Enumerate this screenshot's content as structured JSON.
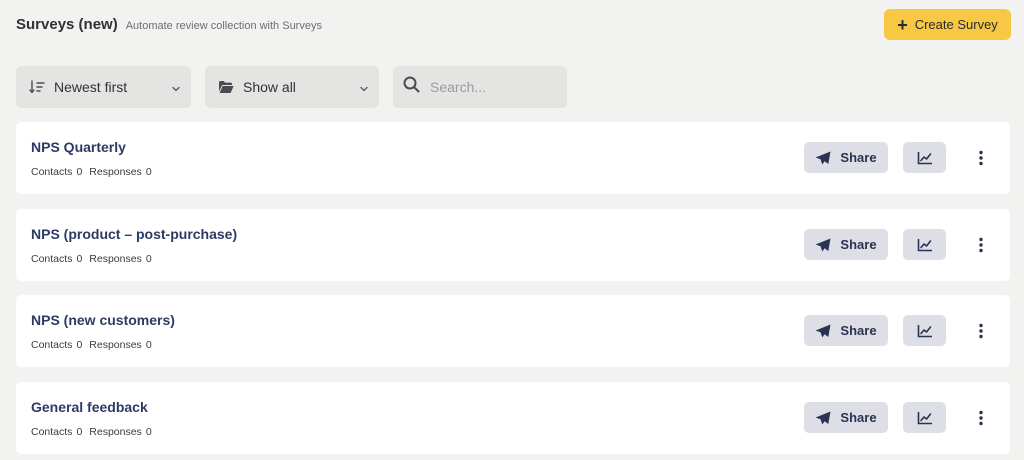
{
  "header": {
    "title": "Surveys (new)",
    "subtitle": "Automate review collection with Surveys",
    "create_label": "Create Survey"
  },
  "filters": {
    "sort": {
      "label": "Newest first",
      "icon": "sort-descending-icon"
    },
    "folder": {
      "label": "Show all",
      "icon": "folder-open-icon"
    },
    "search": {
      "placeholder": "Search...",
      "value": ""
    }
  },
  "surveys": [
    {
      "name": "NPS Quarterly",
      "contacts_label": "Contacts",
      "contacts": "0",
      "responses_label": "Responses",
      "responses": "0",
      "share_label": "Share"
    },
    {
      "name": "NPS (product – post-purchase)",
      "contacts_label": "Contacts",
      "contacts": "0",
      "responses_label": "Responses",
      "responses": "0",
      "share_label": "Share"
    },
    {
      "name": "NPS (new customers)",
      "contacts_label": "Contacts",
      "contacts": "0",
      "responses_label": "Responses",
      "responses": "0",
      "share_label": "Share"
    },
    {
      "name": "General feedback",
      "contacts_label": "Contacts",
      "contacts": "0",
      "responses_label": "Responses",
      "responses": "0",
      "share_label": "Share"
    }
  ],
  "colors": {
    "accent": "#f7c844",
    "background": "#f2f2f1",
    "card": "#ffffff",
    "button_bg": "#dedfe6",
    "survey_title": "#2d3b63"
  }
}
